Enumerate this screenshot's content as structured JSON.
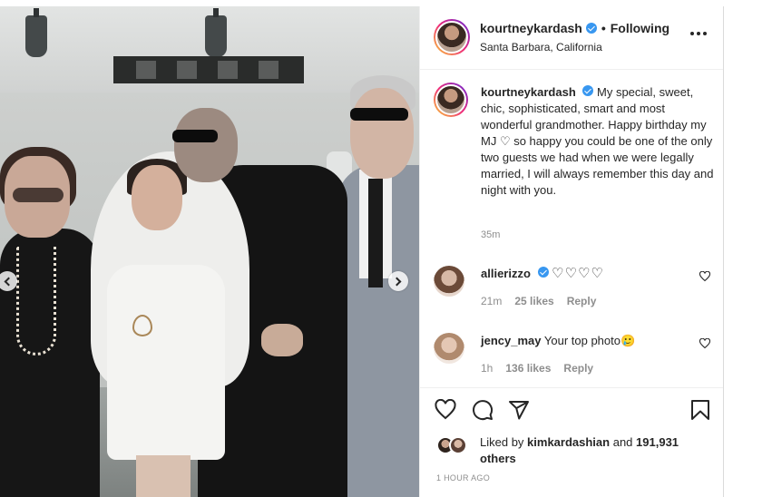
{
  "post": {
    "username": "kourtneykardash",
    "follow_status": "Following",
    "location": "Santa Barbara, California"
  },
  "caption": {
    "username": "kourtneykardash",
    "text": "My special, sweet, chic, sophisticated, smart and most wonderful grandmother. Happy birthday my MJ ♡ so happy you could be one of the only two guests we had when we were legally married, I will always remember this day and night with you.",
    "time": "35m"
  },
  "comments": [
    {
      "username": "allierizzo",
      "text": "♡♡♡♡",
      "time": "21m",
      "likes": "25 likes",
      "reply": "Reply"
    },
    {
      "username": "jency_may",
      "text": "Your top photo",
      "emoji": "🥲",
      "time": "1h",
      "likes": "136 likes",
      "reply": "Reply"
    }
  ],
  "likes": {
    "prefix": "Liked by",
    "liker": "kimkardashian",
    "and": "and",
    "others": "191,931 others"
  },
  "timestamp": "1 HOUR AGO",
  "colors": {
    "verified": "#3897f0",
    "meta_gray": "#8e8e8e",
    "text": "#262626",
    "story_ring": [
      "#f9ce34",
      "#ee2a7b",
      "#6228d7"
    ]
  },
  "icons": [
    "verified-badge-icon",
    "more-options-icon",
    "heart-icon",
    "comment-icon",
    "share-icon",
    "bookmark-icon",
    "chevron-left-icon",
    "chevron-right-icon"
  ]
}
